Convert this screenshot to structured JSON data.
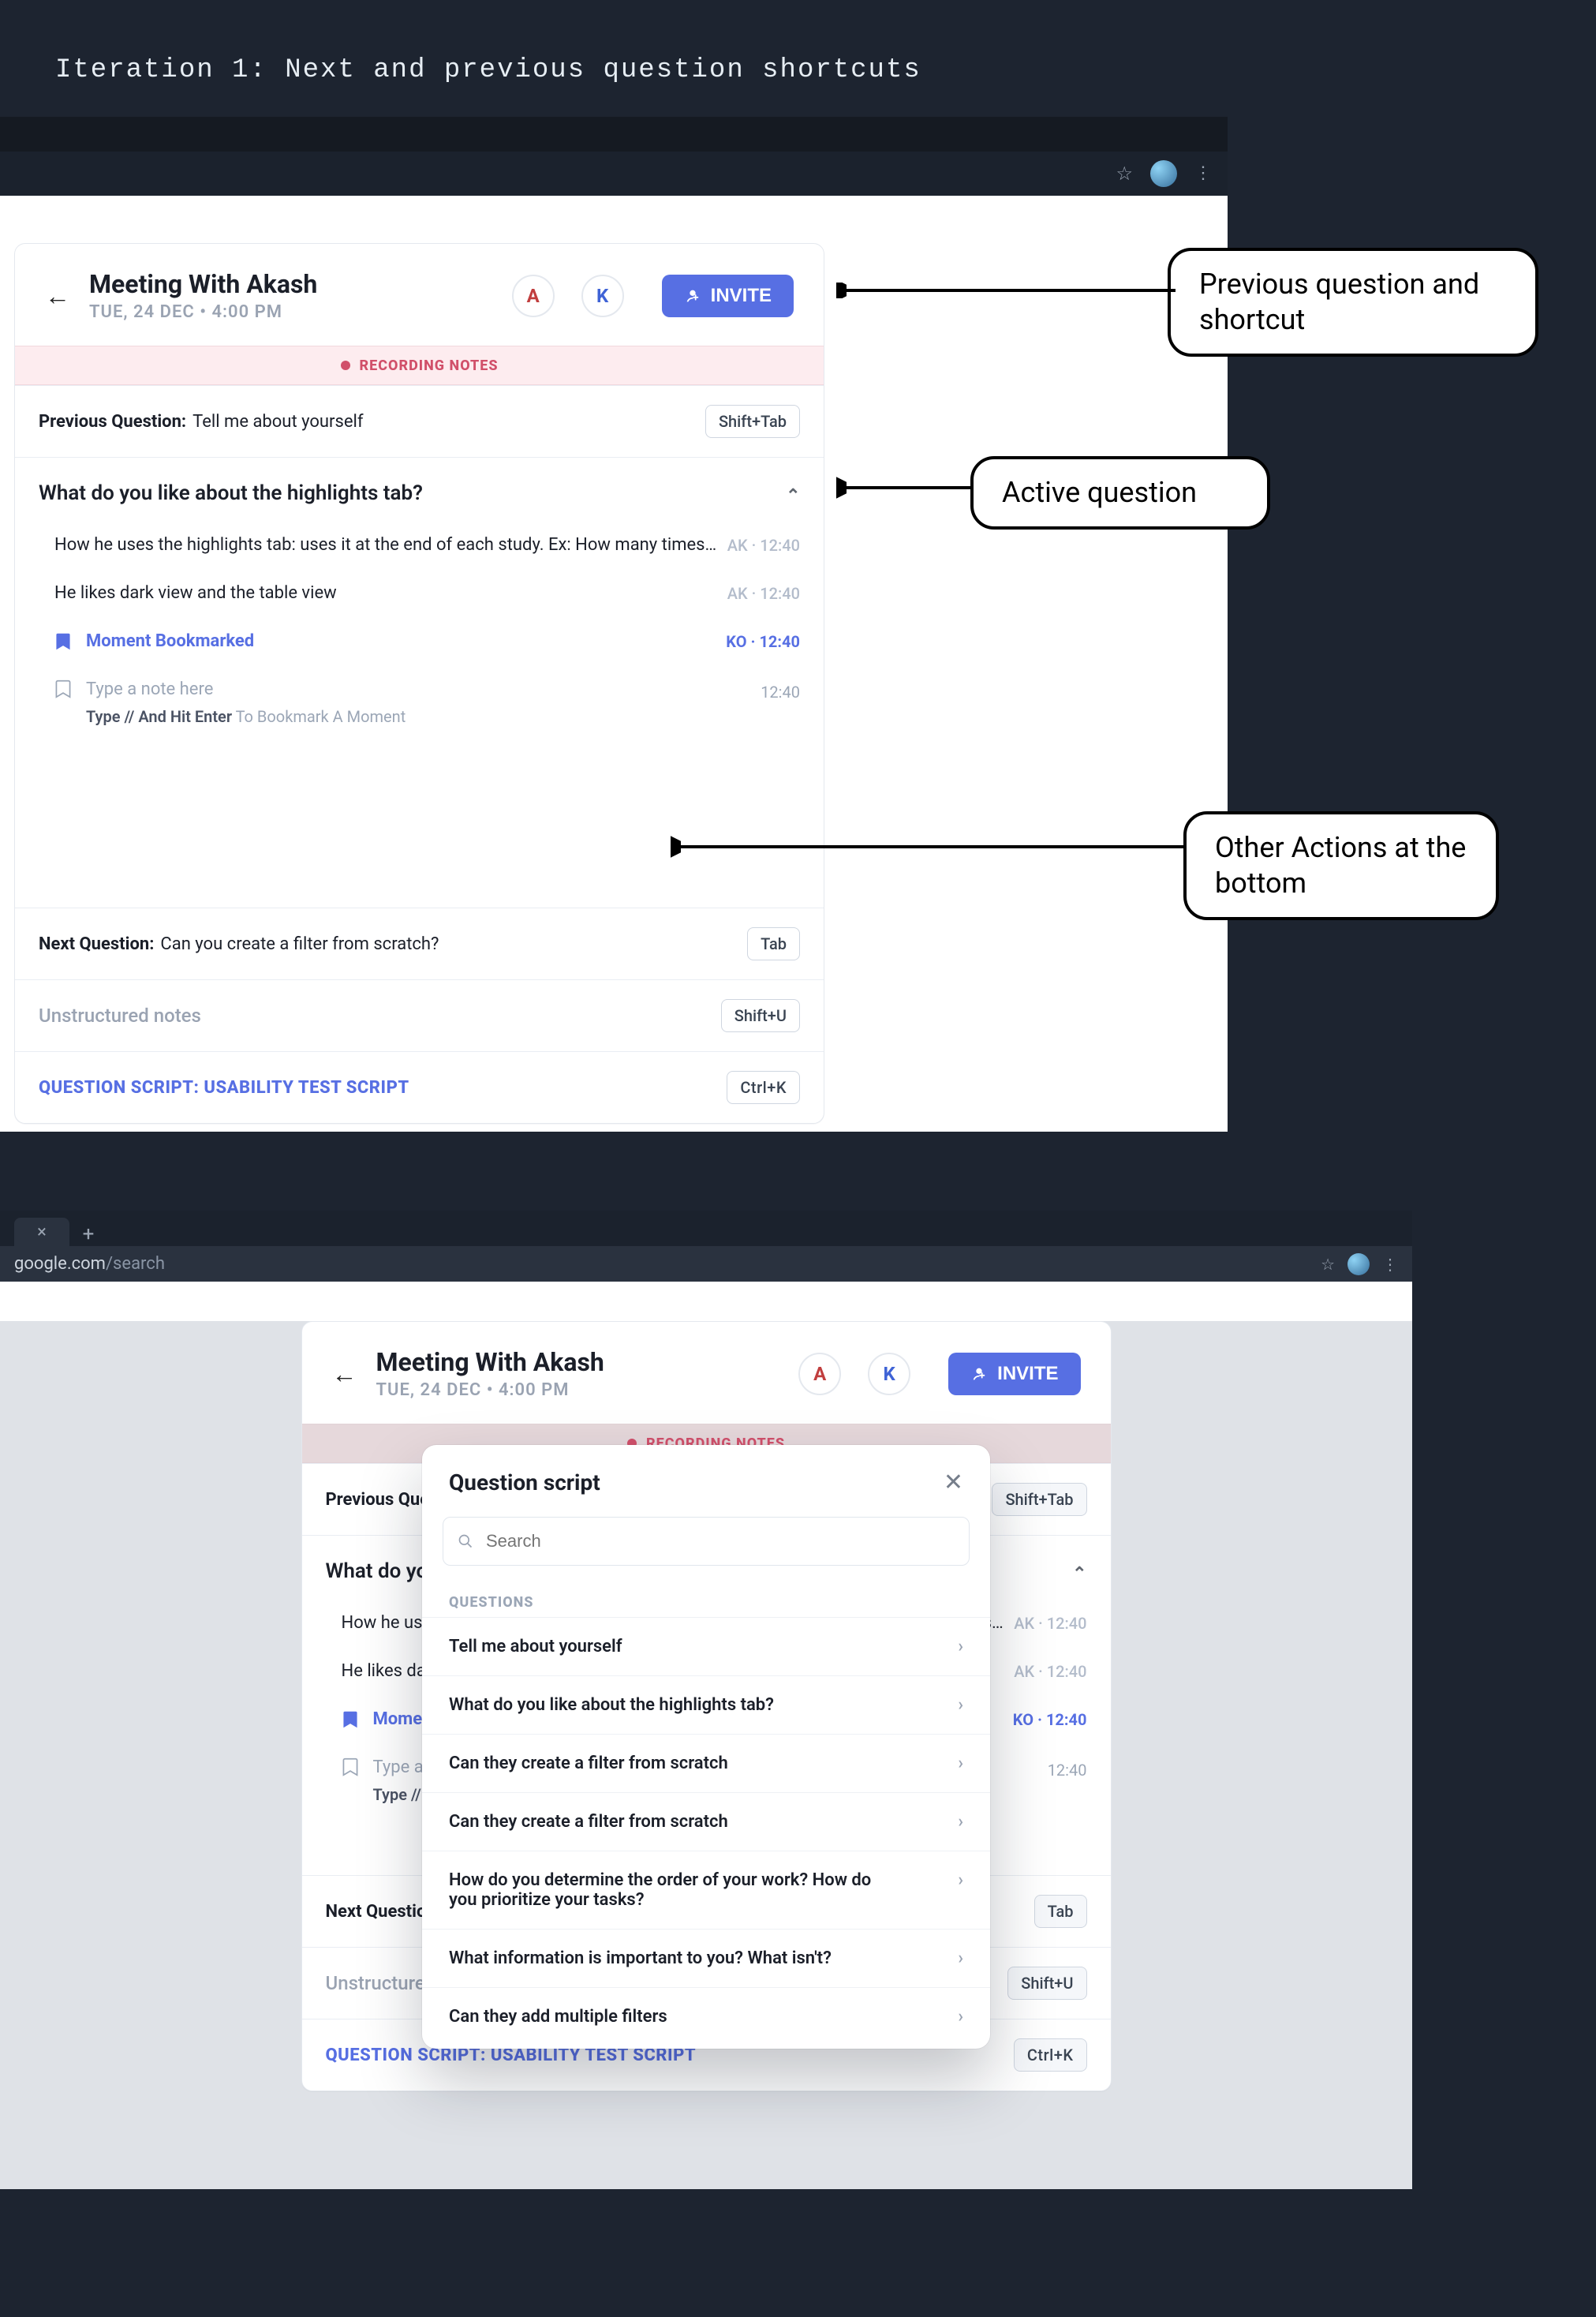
{
  "heading": "Iteration 1: Next and previous question shortcuts",
  "ann": {
    "prev": "Previous question and shortcut",
    "active": "Active question",
    "bottom": "Other Actions at the bottom"
  },
  "meeting": {
    "title": "Meeting With Akash",
    "subtitle": "TUE, 24 DEC • 4:00 PM",
    "recording": "RECORDING NOTES",
    "invite": "INVITE",
    "avatars": {
      "a": "A",
      "k": "K"
    },
    "prev_q_label": "Previous Question:",
    "prev_q": "Tell me about yourself",
    "prev_q_kbd": "Shift+Tab",
    "active_q": "What do you like about the highlights tab?",
    "notes": [
      {
        "body": "How he uses the highlights tab: uses it at the end of each study. Ex: How many times has an",
        "meta": "AK · 12:40"
      },
      {
        "body": "He likes dark view and the table view",
        "meta": "AK · 12:40"
      }
    ],
    "bookmark": {
      "body": "Moment Bookmarked",
      "meta": "KO · 12:40"
    },
    "input": {
      "ph1": "Type a note here",
      "ph2_lead": "Type // And Hit Enter",
      "ph2_rest": "To Bookmark A Moment",
      "time": "12:40"
    },
    "next_q_label": "Next Question:",
    "next_q": "Can you create a filter from scratch?",
    "next_q_kbd": "Tab",
    "unstructured": "Unstructured notes",
    "unstructured_kbd": "Shift+U",
    "script_link": "QUESTION SCRIPT: USABILITY TEST SCRIPT",
    "script_kbd": "Ctrl+K"
  },
  "addr": {
    "lead": "google.com",
    "dim": "/search"
  },
  "modal": {
    "title": "Question script",
    "search_ph": "Search",
    "group": "QUESTIONS",
    "items": [
      "Tell me about yourself",
      "What do you like about the highlights tab?",
      "Can they create a filter from scratch",
      "Can they create a filter from scratch",
      "How do you determine the order of your work? How do you prioritize your tasks?",
      "What information is important to you? What isn't?",
      "Can they add multiple filters"
    ]
  }
}
